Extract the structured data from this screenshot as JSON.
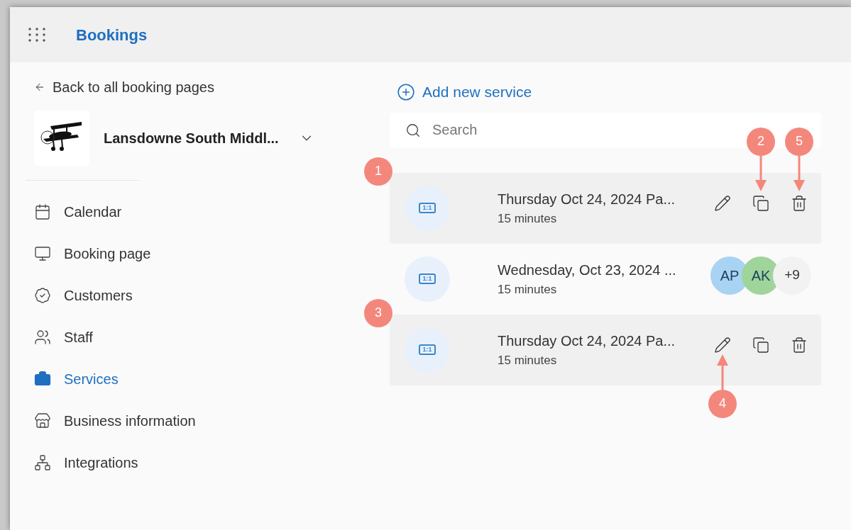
{
  "app": {
    "title": "Bookings"
  },
  "sidebar": {
    "back_link": "Back to all booking pages",
    "business_name": "Lansdowne South Middl...",
    "items": [
      {
        "label": "Calendar",
        "selected": false
      },
      {
        "label": "Booking page",
        "selected": false
      },
      {
        "label": "Customers",
        "selected": false
      },
      {
        "label": "Staff",
        "selected": false
      },
      {
        "label": "Services",
        "selected": true
      },
      {
        "label": "Business information",
        "selected": false
      },
      {
        "label": "Integrations",
        "selected": false
      }
    ]
  },
  "main": {
    "add_button": "Add new service",
    "search": {
      "placeholder": "Search"
    },
    "services": [
      {
        "icon_label": "1:1",
        "title": "Thursday Oct 24, 2024 Pa...",
        "duration": "15 minutes",
        "highlighted": true,
        "callouts": [
          {
            "label": "1",
            "kind": "row"
          },
          {
            "label": "2",
            "kind": "copy"
          },
          {
            "label": "5",
            "kind": "delete"
          }
        ]
      },
      {
        "icon_label": "1:1",
        "title": "Wednesday, Oct 23, 2024 ...",
        "duration": "15 minutes",
        "highlighted": false,
        "staff": [
          {
            "initials": "AP",
            "color": "#a9d3f2"
          },
          {
            "initials": "AK",
            "color": "#9fd49b"
          }
        ],
        "more": "+9"
      },
      {
        "icon_label": "1:1",
        "title": "Thursday Oct 24, 2024 Pa...",
        "duration": "15 minutes",
        "highlighted": true,
        "callouts": [
          {
            "label": "3",
            "kind": "row"
          },
          {
            "label": "4",
            "kind": "edit"
          }
        ]
      }
    ]
  }
}
